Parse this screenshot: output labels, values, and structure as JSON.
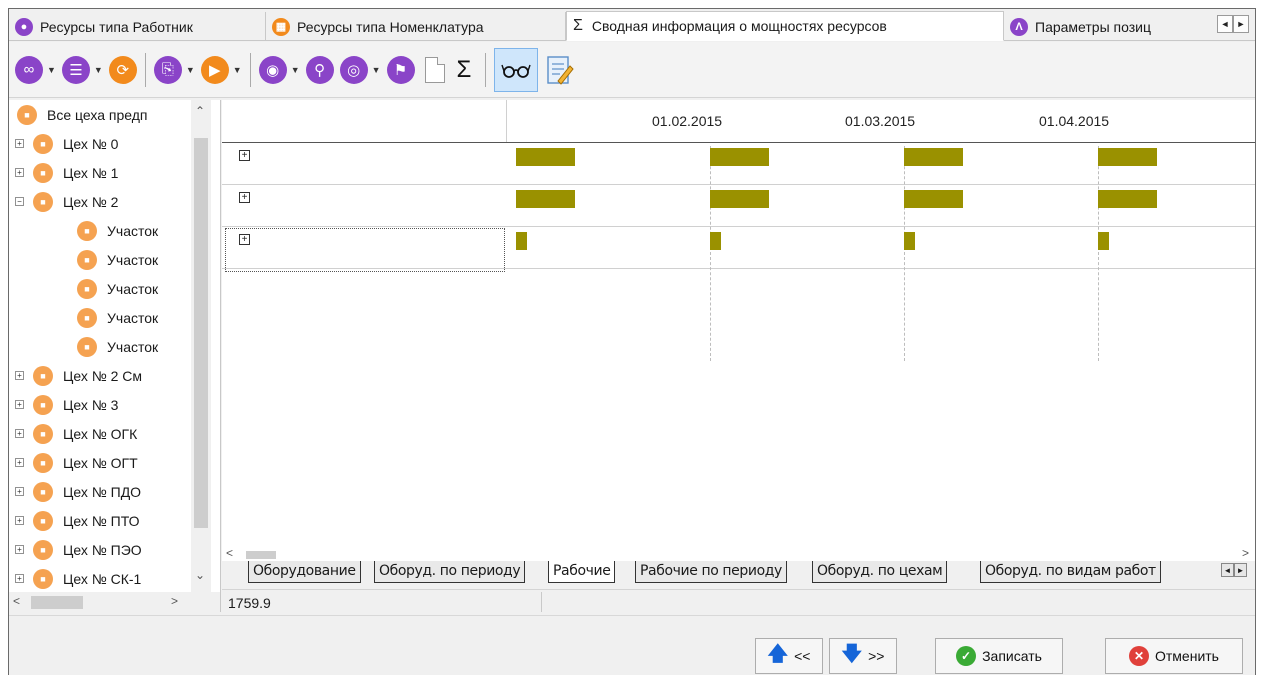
{
  "tabs": [
    {
      "label": "Ресурсы типа Работник",
      "icon": "person-icon"
    },
    {
      "label": "Ресурсы типа Номенклатура",
      "icon": "nomenclature-icon"
    },
    {
      "label": "Сводная информация о мощностях ресурсов",
      "icon": "sigma-icon",
      "active": true
    },
    {
      "label": "Параметры позиц",
      "icon": "parameters-icon"
    }
  ],
  "tab_scroll": {
    "left": "◄",
    "right": "►"
  },
  "toolbar": {
    "sigma": "Σ",
    "glasses": "∞"
  },
  "tree": {
    "root": "Все цеха предп",
    "items": [
      {
        "label": "Цех № 0",
        "expander": "+"
      },
      {
        "label": "Цех № 1",
        "expander": "+"
      },
      {
        "label": "Цех № 2",
        "expander": "−"
      },
      {
        "label": "Участок",
        "expander": ""
      },
      {
        "label": "Участок",
        "expander": ""
      },
      {
        "label": "Участок",
        "expander": ""
      },
      {
        "label": "Участок",
        "expander": ""
      },
      {
        "label": "Участок",
        "expander": ""
      },
      {
        "label": "Цех № 2 См",
        "expander": "+"
      },
      {
        "label": "Цех № 3",
        "expander": "+"
      },
      {
        "label": "Цех № ОГК",
        "expander": "+"
      },
      {
        "label": "Цех № ОГТ",
        "expander": "+"
      },
      {
        "label": "Цех № ПДО",
        "expander": "+"
      },
      {
        "label": "Цех № ПТО",
        "expander": "+"
      },
      {
        "label": "Цех № ПЭО",
        "expander": "+"
      },
      {
        "label": "Цех № СК-1",
        "expander": "+"
      }
    ]
  },
  "timeline": {
    "dates": [
      "01.02.2015",
      "01.03.2015",
      "01.04.2015"
    ],
    "rows": [
      {
        "expander": "+",
        "load": "full"
      },
      {
        "expander": "+",
        "load": "full"
      },
      {
        "expander": "+",
        "load": "small"
      }
    ]
  },
  "sheet_tabs": [
    {
      "label": "Оборудование"
    },
    {
      "label": "Оборуд. по периоду"
    },
    {
      "label": "Рабочие",
      "active": true
    },
    {
      "label": "Рабочие по периоду"
    },
    {
      "label": "Оборуд. по цехам"
    },
    {
      "label": "Оборуд. по видам работ"
    }
  ],
  "status": {
    "value": "1759.9"
  },
  "buttons": {
    "prev": "<<",
    "next": ">>",
    "save": "Записать",
    "cancel": "Отменить"
  },
  "colors": {
    "bar": "#9a9100",
    "accent_purple": "#8a44c8",
    "accent_orange": "#f28a1c",
    "workshop_icon": "#f5a251"
  }
}
